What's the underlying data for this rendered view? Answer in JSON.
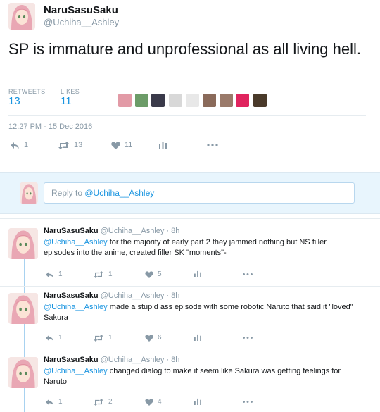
{
  "tweet": {
    "display_name": "NaruSasuSaku",
    "handle": "@Uchiha__Ashley",
    "text": "SP is immature and unprofessional as all living hell.",
    "retweets_label": "RETWEETS",
    "retweets_count": "13",
    "likes_label": "LIKES",
    "likes_count": "11",
    "timestamp": "12:27 PM - 15 Dec 2016",
    "actions": {
      "reply_count": "1",
      "retweet_count": "13",
      "like_count": "11"
    },
    "liker_avatars": [
      "#e29aa6",
      "#6c9c68",
      "#3a3a4a",
      "#d8d8d8",
      "#e8e8e8",
      "#8a6a5a",
      "#9a7a6a",
      "#e0245e",
      "#4a3a2a"
    ]
  },
  "reply_box": {
    "prefix": "Reply to ",
    "mention": "@Uchiha__Ashley"
  },
  "replies": [
    {
      "name": "NaruSasuSaku",
      "handle": "@Uchiha__Ashley",
      "time": "· 8h",
      "mention": "@Uchiha__Ashley",
      "text": " for the majority of early part 2 they jammed nothing but NS filler episodes into the anime, created filler SK \"moments\"-",
      "reply_count": "1",
      "retweet_count": "1",
      "like_count": "5"
    },
    {
      "name": "NaruSasuSaku",
      "handle": "@Uchiha__Ashley",
      "time": "· 8h",
      "mention": "@Uchiha__Ashley",
      "text": " made a stupid ass episode with some robotic Naruto that said it \"loved\" Sakura",
      "reply_count": "1",
      "retweet_count": "1",
      "like_count": "6"
    },
    {
      "name": "NaruSasuSaku",
      "handle": "@Uchiha__Ashley",
      "time": "· 8h",
      "mention": "@Uchiha__Ashley",
      "text": " changed dialog to make it seem like Sakura was getting feelings for Naruto",
      "reply_count": "1",
      "retweet_count": "2",
      "like_count": "4"
    }
  ],
  "icons": {
    "reply": "reply-icon",
    "retweet": "retweet-icon",
    "like": "heart-icon",
    "analytics": "analytics-icon",
    "more": "more-icon"
  },
  "colors": {
    "link": "#1b95e0",
    "muted": "#8899a6",
    "reply_bg": "#e8f5fd"
  }
}
